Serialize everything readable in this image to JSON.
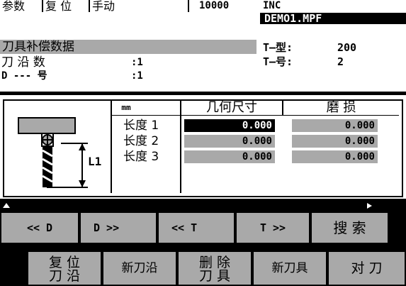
{
  "status": {
    "params": "参数",
    "reset": "复 位",
    "mode": "手动",
    "increment": "10000",
    "inc": "INC",
    "program": "DEMO1.MPF"
  },
  "info": {
    "title": "刀具补偿数据",
    "edge_count_label": "刀 沿 数",
    "edge_count_value": ":1",
    "d_no_label": "D --- 号",
    "d_no_value": ":1",
    "t_type_label": "T–型:",
    "t_type_value": "200",
    "t_no_label": "T–号:",
    "t_no_value": "2"
  },
  "table": {
    "unit_header": "mm",
    "geometry_header": "几何尺寸",
    "wear_header": "磨  损",
    "tool_label": "L1",
    "rows": [
      {
        "label": "长度 1",
        "geometry": "0.000",
        "wear": "0.000"
      },
      {
        "label": "长度 2",
        "geometry": "0.000",
        "wear": "0.000"
      },
      {
        "label": "长度 3",
        "geometry": "0.000",
        "wear": "0.000"
      }
    ]
  },
  "softkeys_row1": [
    {
      "label": "<< D"
    },
    {
      "label": "D >>"
    },
    {
      "label": "<< T"
    },
    {
      "label": "T >>"
    },
    {
      "label": "搜 索"
    }
  ],
  "softkeys_row2": [
    {
      "line1": "复 位",
      "line2": "刀 沿"
    },
    {
      "label": "新刀沿"
    },
    {
      "line1": "删 除",
      "line2": "刀 具"
    },
    {
      "label": "新刀具"
    },
    {
      "label": "对 刀"
    }
  ],
  "colors": {
    "panel": "#ffffff",
    "field": "#a9a9a9",
    "background": "#000000"
  }
}
